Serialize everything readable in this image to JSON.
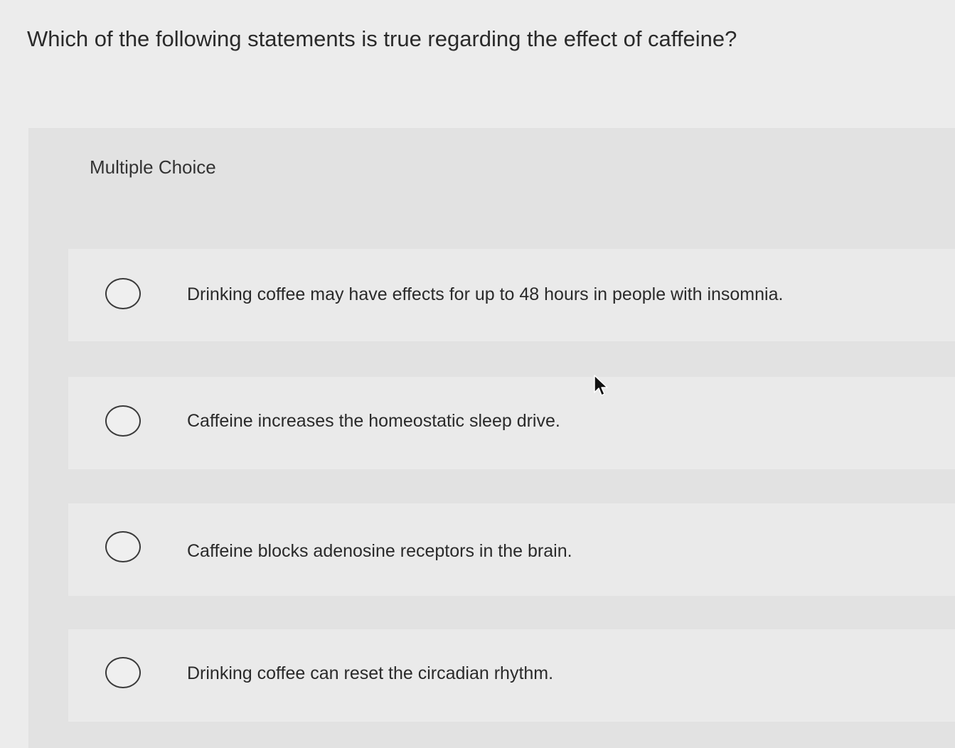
{
  "question": {
    "text": "Which of the following statements is true regarding the effect of caffeine?"
  },
  "multiple_choice": {
    "header": "Multiple Choice",
    "options": [
      {
        "label": "Drinking coffee may have effects for up to 48 hours in people with insomnia.",
        "selected": false
      },
      {
        "label": "Caffeine increases the homeostatic sleep drive.",
        "selected": false
      },
      {
        "label": "Caffeine blocks adenosine receptors in the brain.",
        "selected": false
      },
      {
        "label": "Drinking coffee can reset the circadian rhythm.",
        "selected": false
      }
    ]
  },
  "icons": {
    "radio": "radio-button-icon",
    "cursor": "mouse-pointer-icon"
  },
  "colors": {
    "background": "#ececec",
    "panel": "#e2e2e2",
    "text": "#2a2a2a"
  }
}
